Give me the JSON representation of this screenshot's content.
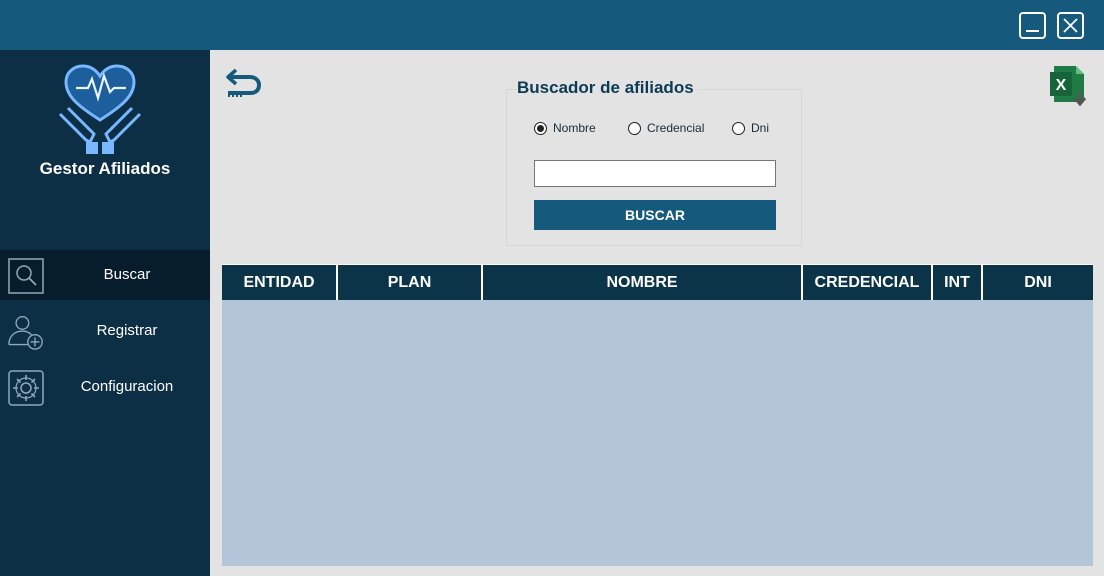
{
  "window": {
    "minimize_icon": "minimize-icon",
    "close_icon": "close-icon"
  },
  "sidebar": {
    "app_name": "Gestor Afiliados",
    "logo_icon": "heart-hands-icon",
    "items": [
      {
        "label": "Buscar",
        "icon": "search-icon",
        "active": true
      },
      {
        "label": "Registrar",
        "icon": "add-user-icon",
        "active": false
      },
      {
        "label": "Configuracion",
        "icon": "gear-icon",
        "active": false
      }
    ]
  },
  "toolbar": {
    "back_icon": "back-arrow-icon",
    "export_icon": "excel-export-icon"
  },
  "search": {
    "title": "Buscador de afiliados",
    "options": [
      {
        "label": "Nombre",
        "checked": true
      },
      {
        "label": "Credencial",
        "checked": false
      },
      {
        "label": "Dni",
        "checked": false
      }
    ],
    "input_value": "",
    "button_label": "BUSCAR"
  },
  "table": {
    "columns": [
      "ENTIDAD",
      "PLAN",
      "NOMBRE",
      "CREDENCIAL",
      "INT",
      "DNI"
    ],
    "rows": []
  },
  "colors": {
    "titlebar": "#155a7d",
    "sidebar": "#0c2f45",
    "accent": "#155a7d",
    "grid_bg": "#b3c6d7",
    "grid_header": "#0c3448"
  }
}
